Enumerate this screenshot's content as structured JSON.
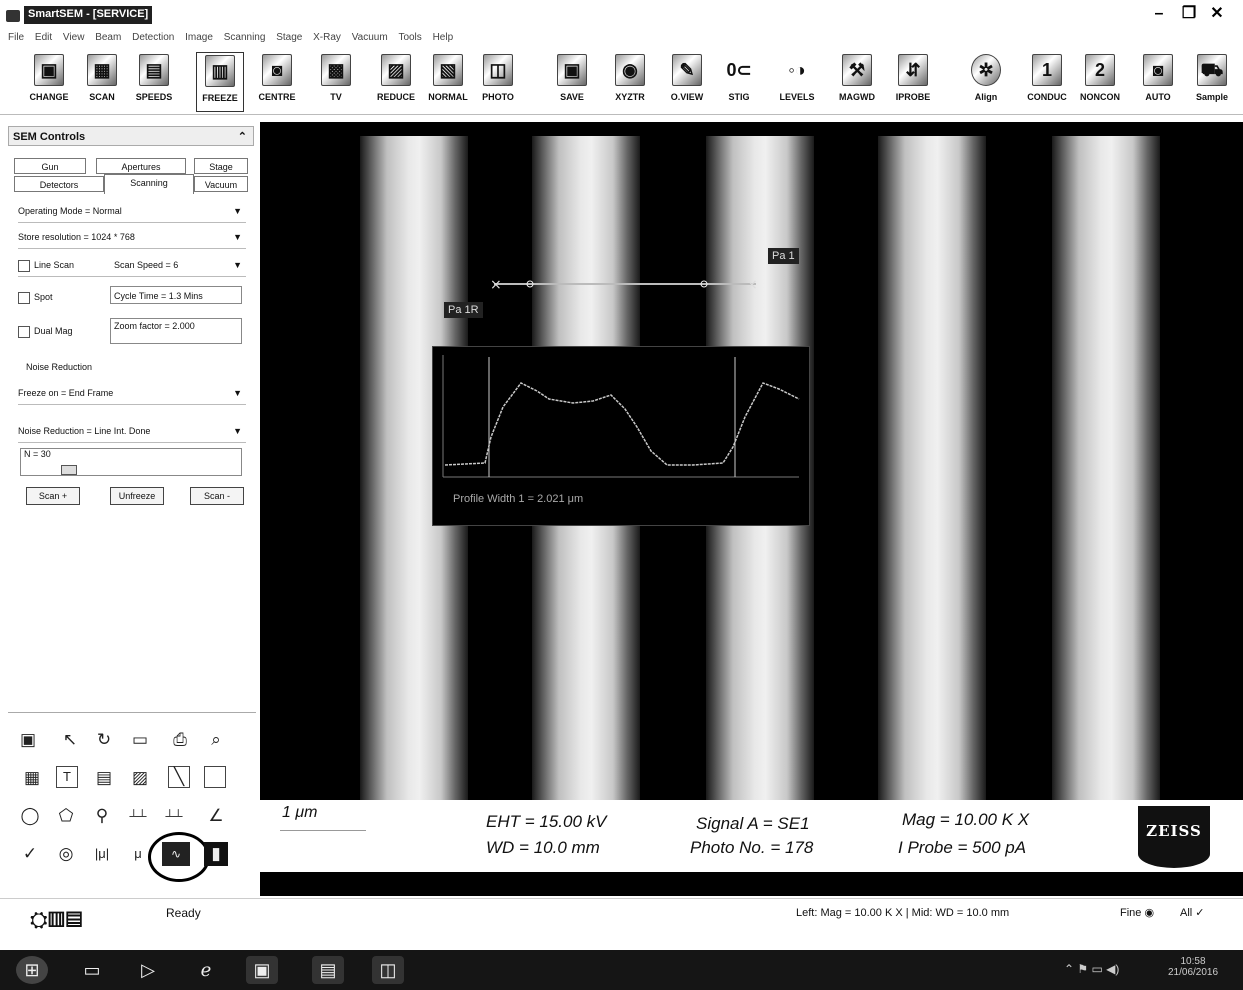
{
  "window": {
    "title": "SmartSEM - [SERVICE]",
    "controls": {
      "minimize": "–",
      "restore": "❐",
      "close": "✕"
    }
  },
  "menu": [
    "File",
    "Edit",
    "View",
    "Beam",
    "Detection",
    "Image",
    "Scanning",
    "Stage",
    "X-Ray",
    "Vacuum",
    "Tools",
    "Help"
  ],
  "toolbar": {
    "buttons": [
      {
        "label": "CHANGE",
        "icon": "monitor-icon"
      },
      {
        "label": "SCAN",
        "icon": "scan-icon"
      },
      {
        "label": "SPEEDS",
        "icon": "speeds-icon"
      },
      {
        "label": "FREEZE",
        "icon": "freeze-icon"
      },
      {
        "label": "CENTRE",
        "icon": "centre-icon"
      },
      {
        "label": "TV",
        "icon": "tv-icon"
      },
      {
        "label": "REDUCE",
        "icon": "reduce-icon"
      },
      {
        "label": "NORMAL",
        "icon": "normal-icon"
      },
      {
        "label": "PHOTO",
        "icon": "camera-icon"
      },
      {
        "label": "SAVE",
        "icon": "save-icon"
      },
      {
        "label": "XYZTR",
        "icon": "xyztr-icon"
      },
      {
        "label": "O.VIEW",
        "icon": "overview-icon"
      },
      {
        "label": "STIG",
        "icon": "stig-icon"
      },
      {
        "label": "LEVELS",
        "icon": "levels-icon"
      },
      {
        "label": "MAGWD",
        "icon": "magwd-icon"
      },
      {
        "label": "IPROBE",
        "icon": "iprobe-icon"
      },
      {
        "label": "Align",
        "icon": "align-icon"
      },
      {
        "label": "CONDUC",
        "icon": "conduc-icon",
        "glyph": "1"
      },
      {
        "label": "NONCON",
        "icon": "noncon-icon",
        "glyph": "2"
      },
      {
        "label": "AUTO",
        "icon": "auto-icon"
      },
      {
        "label": "Sample",
        "icon": "sample-icon"
      }
    ]
  },
  "sem_controls": {
    "title": "SEM Controls",
    "tabs_row1": [
      "Gun",
      "Apertures",
      "Stage"
    ],
    "tabs_row2": [
      "Detectors",
      "Scanning",
      "Vacuum"
    ],
    "active_tab": "Scanning",
    "operating_mode": "Operating Mode = Normal",
    "store_resolution": "Store resolution = 1024 * 768",
    "line_scan": "Line Scan",
    "scan_speed": "Scan Speed = 6",
    "spot": "Spot",
    "cycle_time": "Cycle Time = 1.3  Mins",
    "dual_mag": "Dual Mag",
    "zoom_factor": "Zoom factor =  2.000",
    "noise_reduction_label": "Noise Reduction",
    "freeze_on": "Freeze on = End Frame",
    "noise_reduction_value": "Noise Reduction = Line Int. Done",
    "n_value": "N = 30",
    "scan_plus": "Scan +",
    "unfreeze": "Unfreeze",
    "scan_minus": "Scan -"
  },
  "image": {
    "label_pa1r": "Pa 1R",
    "label_pa1": "Pa 1",
    "profile_width": "Profile Width 1 = 2.021 μm",
    "colors": {
      "background": "#000000",
      "stripe_center": "#f0f0f0",
      "profile_trace": "#c8c8c8"
    }
  },
  "databar": {
    "scale": "1 μm",
    "eht": "EHT = 15.00 kV",
    "wd": "WD = 10.0 mm",
    "signal": "Signal A = SE1",
    "photo_no": "Photo No. = 178",
    "mag": "Mag =   10.00 K X",
    "iprobe": "I Probe =    500 pA",
    "logo": "ZEISS"
  },
  "annotation_tools": [
    "image-icon",
    "cursor-icon",
    "rotate-icon",
    "folder-icon",
    "print-icon",
    "zoom-icon",
    "stamp-icon",
    "text-icon",
    "layers-icon",
    "photo-icon",
    "line-icon",
    "rectangle-icon",
    "ellipse-icon",
    "polygon-icon",
    "measure-icon",
    "horizontal-marker-icon",
    "horizontal-measure-icon",
    "angle-icon",
    "tick-icon",
    "circle-icon",
    "micron-marker-icon",
    "micron-scale-icon",
    "line-profile-icon",
    "bar-icon"
  ],
  "status": {
    "text": "Ready",
    "right": "Left: Mag =   10.00 K X | Mid: WD = 10.0 mm",
    "fine": "Fine",
    "all": "All"
  },
  "taskbar": {
    "time": "10:58",
    "date": "21/06/2016"
  }
}
